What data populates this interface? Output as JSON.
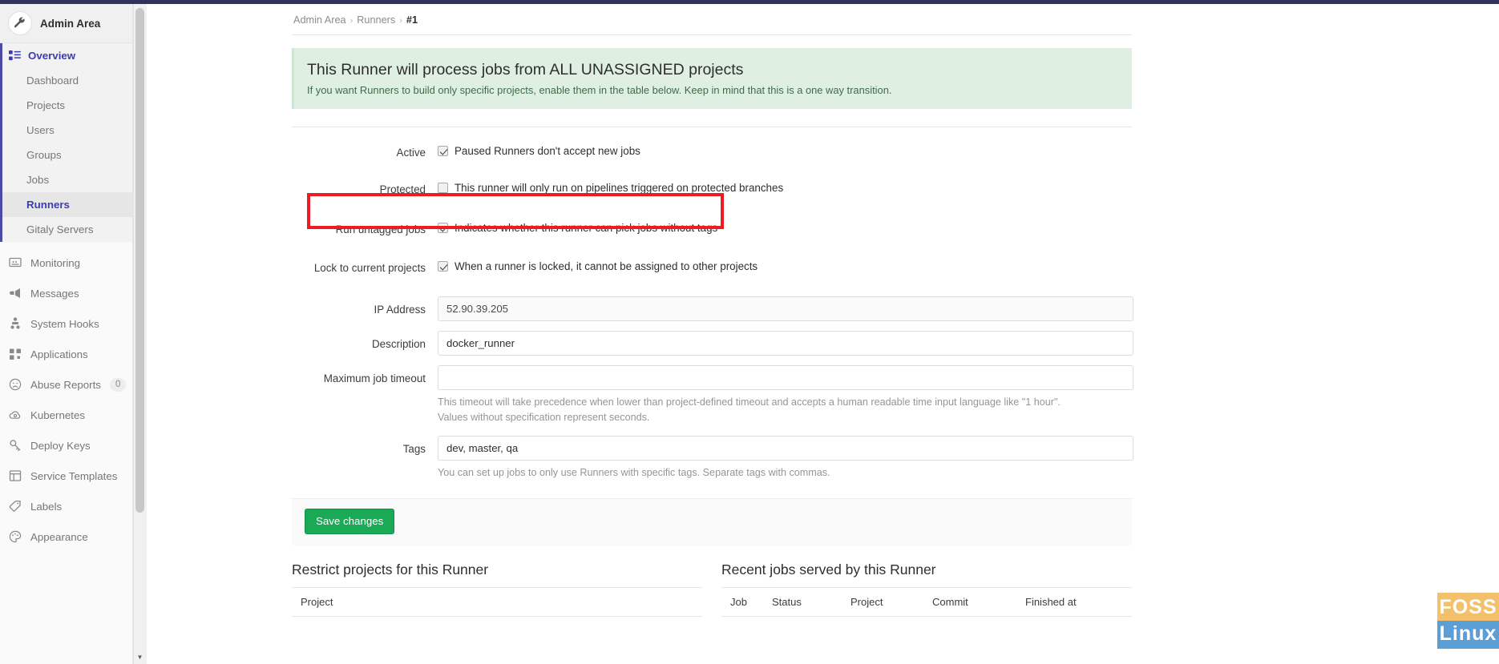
{
  "sidebar": {
    "context_title": "Admin Area",
    "avatar_icon": "wrench-icon",
    "overview": {
      "label": "Overview",
      "icon": "overview-grid-icon"
    },
    "sub_items": [
      {
        "label": "Dashboard"
      },
      {
        "label": "Projects"
      },
      {
        "label": "Users"
      },
      {
        "label": "Groups"
      },
      {
        "label": "Jobs"
      },
      {
        "label": "Runners"
      },
      {
        "label": "Gitaly Servers"
      }
    ],
    "main_items": [
      {
        "label": "Monitoring",
        "icon": "monitor-icon",
        "count": ""
      },
      {
        "label": "Messages",
        "icon": "megaphone-icon",
        "count": ""
      },
      {
        "label": "System Hooks",
        "icon": "hook-icon",
        "count": ""
      },
      {
        "label": "Applications",
        "icon": "apps-grid-icon",
        "count": ""
      },
      {
        "label": "Abuse Reports",
        "icon": "sad-face-icon",
        "count": "0"
      },
      {
        "label": "Kubernetes",
        "icon": "cloud-gear-icon",
        "count": ""
      },
      {
        "label": "Deploy Keys",
        "icon": "key-icon",
        "count": ""
      },
      {
        "label": "Service Templates",
        "icon": "template-icon",
        "count": ""
      },
      {
        "label": "Labels",
        "icon": "label-tag-icon",
        "count": ""
      },
      {
        "label": "Appearance",
        "icon": "palette-icon",
        "count": ""
      }
    ]
  },
  "breadcrumb": {
    "items": [
      "Admin Area",
      "Runners"
    ],
    "current": "#1",
    "separator": "›"
  },
  "alert": {
    "title": "This Runner will process jobs from ALL UNASSIGNED projects",
    "subtitle": "If you want Runners to build only specific projects, enable them in the table below. Keep in mind that this is a one way transition."
  },
  "form": {
    "active": {
      "label": "Active",
      "checkbox_label": "Paused Runners don't accept new jobs",
      "checked": true
    },
    "protected": {
      "label": "Protected",
      "checkbox_label": "This runner will only run on pipelines triggered on protected branches",
      "checked": false
    },
    "run_untagged": {
      "label": "Run untagged jobs",
      "checkbox_label": "Indicates whether this runner can pick jobs without tags",
      "checked": true
    },
    "lock_projects": {
      "label": "Lock to current projects",
      "checkbox_label": "When a runner is locked, it cannot be assigned to other projects",
      "checked": true
    },
    "ip_address": {
      "label": "IP Address",
      "value": "52.90.39.205",
      "placeholder": ""
    },
    "description": {
      "label": "Description",
      "value": "docker_runner",
      "placeholder": ""
    },
    "max_job_timeout": {
      "label": "Maximum job timeout",
      "value": "",
      "placeholder": "",
      "help": "This timeout will take precedence when lower than project-defined timeout and accepts a human readable time input language like \"1 hour\". Values without specification represent seconds."
    },
    "tags": {
      "label": "Tags",
      "value": "dev, master, qa",
      "placeholder": "",
      "help": "You can set up jobs to only use Runners with specific tags. Separate tags with commas."
    },
    "save_label": "Save changes"
  },
  "restrict_projects": {
    "title": "Restrict projects for this Runner",
    "columns": [
      "Project"
    ]
  },
  "recent_jobs": {
    "title": "Recent jobs served by this Runner",
    "columns": [
      "Job",
      "Status",
      "Project",
      "Commit",
      "Finished at"
    ]
  },
  "watermark": {
    "line1": "FOSS",
    "line2": "Linux"
  },
  "annotation": {
    "target": "run-untagged-jobs-row",
    "color": "#ed1c24"
  }
}
